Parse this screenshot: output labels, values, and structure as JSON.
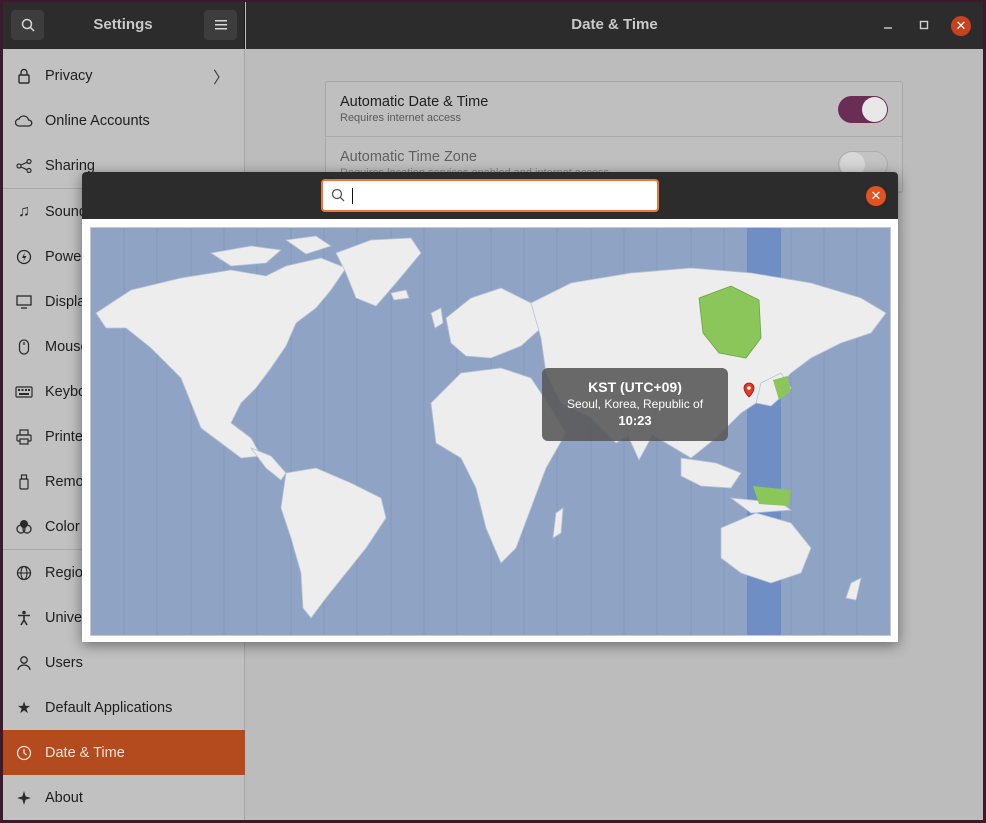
{
  "header": {
    "left_title": "Settings",
    "right_title": "Date & Time",
    "search_icon": "search-icon",
    "menu_icon": "hamburger-menu-icon",
    "minimize_icon": "minimize-icon",
    "maximize_icon": "maximize-icon",
    "close_icon": "close-icon"
  },
  "sidebar": {
    "items": [
      {
        "label": "Privacy",
        "icon": "lock-icon"
      },
      {
        "label": "Online Accounts",
        "icon": "cloud-icon"
      },
      {
        "label": "Sharing",
        "icon": "share-icon"
      },
      {
        "label": "Sound",
        "icon": "music-note-icon"
      },
      {
        "label": "Power",
        "icon": "power-icon"
      },
      {
        "label": "Displays",
        "icon": "display-icon"
      },
      {
        "label": "Mouse & Touchpad",
        "icon": "mouse-icon"
      },
      {
        "label": "Keyboard Shortcuts",
        "icon": "keyboard-icon"
      },
      {
        "label": "Printers",
        "icon": "printer-icon"
      },
      {
        "label": "Removable Media",
        "icon": "usb-icon"
      },
      {
        "label": "Color",
        "icon": "color-icon"
      },
      {
        "label": "Region & Language",
        "icon": "globe-icon"
      },
      {
        "label": "Universal Access",
        "icon": "accessibility-icon"
      },
      {
        "label": "Users",
        "icon": "users-icon"
      },
      {
        "label": "Default Applications",
        "icon": "star-icon"
      },
      {
        "label": "Date & Time",
        "icon": "clock-icon"
      },
      {
        "label": "About",
        "icon": "plus-icon"
      }
    ]
  },
  "content": {
    "auto_date_time": {
      "title": "Automatic Date & Time",
      "subtitle": "Requires internet access",
      "enabled": true
    },
    "auto_time_zone": {
      "title": "Automatic Time Zone",
      "subtitle": "Requires location services enabled and internet access",
      "enabled": false
    }
  },
  "timezone_dialog": {
    "search_value": "",
    "tooltip": {
      "zone": "KST (UTC+09)",
      "city": "Seoul, Korea, Republic of",
      "time": "10:23"
    },
    "colors": {
      "ocean": "#8fa4c4",
      "land": "#ededed",
      "selected_band": "#6f8fc4",
      "highlight": "#8ac65a",
      "marker": "#e23a2a"
    }
  }
}
